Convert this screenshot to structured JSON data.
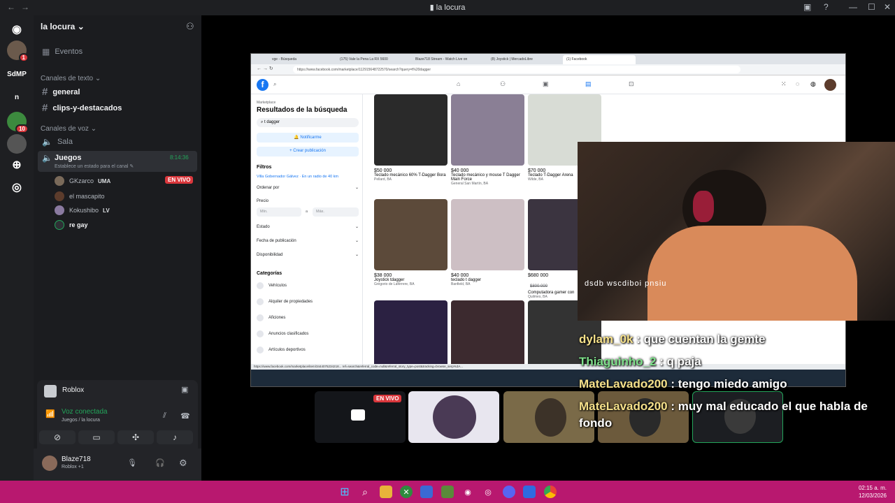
{
  "window": {
    "title": "la locura"
  },
  "rail": {
    "servers": [
      {
        "label": "SdMP"
      },
      {
        "label": "n"
      }
    ],
    "badges": [
      "1",
      "10"
    ]
  },
  "sidebar": {
    "guild_name": "la locura",
    "events_label": "Eventos",
    "text_category": "Canales de texto",
    "text_channels": [
      "general",
      "clips-y-destacados"
    ],
    "voice_category": "Canales de voz",
    "voice_channels": [
      {
        "name": "Sala"
      },
      {
        "name": "Juegos",
        "status": "Establece un estado para el canal",
        "timer": "8:14:36"
      }
    ],
    "voice_users": [
      {
        "name": "GKzarco",
        "tag": "UMA",
        "live": "EN VIVO"
      },
      {
        "name": "el mascapito"
      },
      {
        "name": "Kokushibo",
        "tag": "LV"
      },
      {
        "name": "re gay"
      }
    ]
  },
  "activity": {
    "game": "Roblox",
    "voice_status": "Voz conectada",
    "voice_channel": "Juegos / la locura"
  },
  "user": {
    "name": "Blaze718",
    "status": "Roblox +1"
  },
  "browser": {
    "tabs": [
      "vge - Búsqueda",
      "(175) Vale la Pena La RX 5600",
      "Blaze718 Stream - Watch Live on",
      "(8) Joystick | MercadoLibre",
      "(1) Facebook"
    ],
    "url": "https://www.facebook.com/marketplace/112915648722570/search?query=t%20dagger",
    "status_url": "https://www.facebook.com/marketplace/item/3444075234218... ref=search&referral_code=null&referral_story_type=post&tracking=browse_serp%3A..."
  },
  "marketplace": {
    "breadcrumb": "Marketplace",
    "heading": "Resultados de la búsqueda",
    "search_value": "t dagger",
    "notify_button": "Notificarme",
    "create_button": "+ Crear publicación",
    "filters_label": "Filtros",
    "location": "Villa Gobernador Gálvez · En un radio de 40 km",
    "sort_label": "Ordenar por",
    "price_label": "Precio",
    "min_placeholder": "Mín.",
    "max_placeholder": "Máx.",
    "a_label": "a",
    "state_label": "Estado",
    "date_label": "Fecha de publicación",
    "availability_label": "Disponibilidad",
    "categories_label": "Categorías",
    "categories": [
      "Vehículos",
      "Alquiler de propiedades",
      "Aficiones",
      "Anuncios clasificados",
      "Artículos deportivos"
    ],
    "listings": [
      {
        "price": "$50 000",
        "title": "Teclado mecánico 60% T-Dagger Bora",
        "loc": "Pellard, BA",
        "color": "#2a2a2a"
      },
      {
        "price": "$40 000",
        "title": "Teclado mecánico y mouse T Dagger Main Force",
        "loc": "General San Martín, BA",
        "color": "#8a7f95"
      },
      {
        "price": "$70 000",
        "title": "Teclado T-Dagger Arena",
        "loc": "Wilde, BA",
        "color": "#d8dcd5"
      },
      {
        "price": "$38 000",
        "title": "Joystick tdagger",
        "loc": "Gregorio de Laferrere, BA",
        "color": "#5c4a3a"
      },
      {
        "price": "$40 000",
        "title": "teclado t dagger",
        "loc": "Banfield, BA",
        "color": "#cdbfc4"
      },
      {
        "price": "$680 000",
        "old_price": "$800 000",
        "title": "Computadora gamer con",
        "loc": "Quilmes, BA",
        "color": "#3b3440"
      },
      {
        "price": "",
        "title": "",
        "loc": "",
        "color": "#2b2142"
      },
      {
        "price": "",
        "title": "",
        "loc": "",
        "color": "#3c2a2f"
      },
      {
        "price": "",
        "title": "",
        "loc": "",
        "color": "#333"
      }
    ]
  },
  "webcam": {
    "caption": "dsdb wscdiboi pnsiu"
  },
  "chat": [
    {
      "user": "dylam_0k",
      "text": "que cuentan la gemte",
      "color": "#f5e08a"
    },
    {
      "user": "Thiaguinho_2",
      "text": "q paja",
      "color": "#7ee08a"
    },
    {
      "user": "MateLavado200",
      "text": "tengo miedo amigo",
      "color": "#f5e08a"
    },
    {
      "user": "MateLavado200",
      "text": "muy mal educado el que habla de fondo",
      "color": "#f5e08a"
    }
  ],
  "tiles": {
    "live": "EN VIVO"
  },
  "taskbar": {
    "time": "02:15 a. m.",
    "date": "12/03/2026"
  }
}
